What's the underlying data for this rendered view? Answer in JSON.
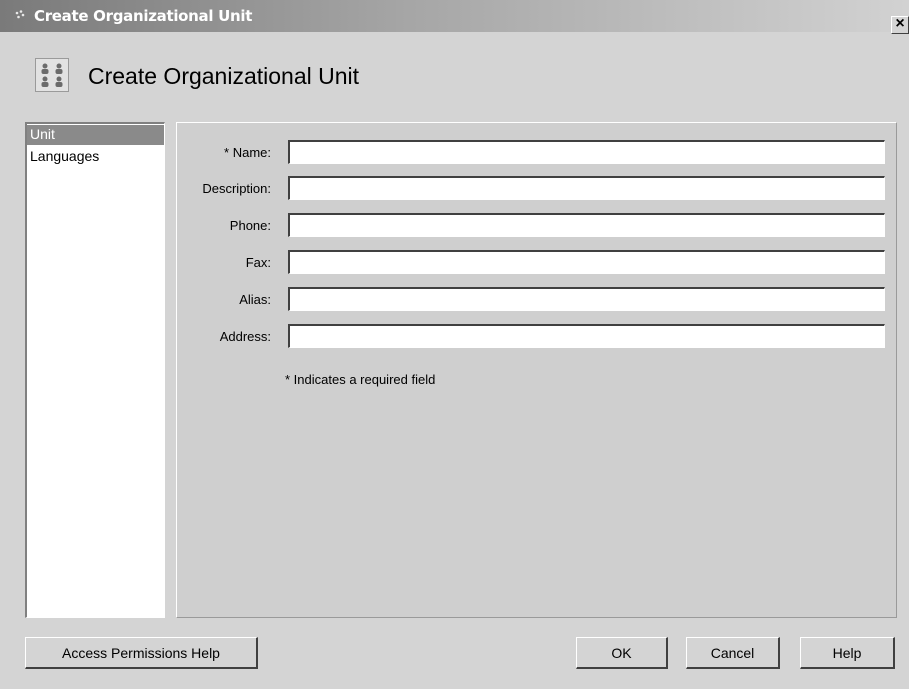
{
  "window": {
    "title": "Create Organizational Unit",
    "close_label": "×"
  },
  "header": {
    "title": "Create Organizational Unit",
    "icon": "org-unit-icon"
  },
  "nav": {
    "items": [
      {
        "label": "Unit",
        "selected": true
      },
      {
        "label": "Languages",
        "selected": false
      }
    ]
  },
  "form": {
    "fields": [
      {
        "label": "* Name:",
        "value": ""
      },
      {
        "label": "Description:",
        "value": ""
      },
      {
        "label": "Phone:",
        "value": ""
      },
      {
        "label": "Fax:",
        "value": ""
      },
      {
        "label": "Alias:",
        "value": ""
      },
      {
        "label": "Address:",
        "value": ""
      }
    ],
    "required_note": "* Indicates a required field"
  },
  "buttons": {
    "access_help": "Access Permissions Help",
    "ok": "OK",
    "cancel": "Cancel",
    "help": "Help"
  }
}
